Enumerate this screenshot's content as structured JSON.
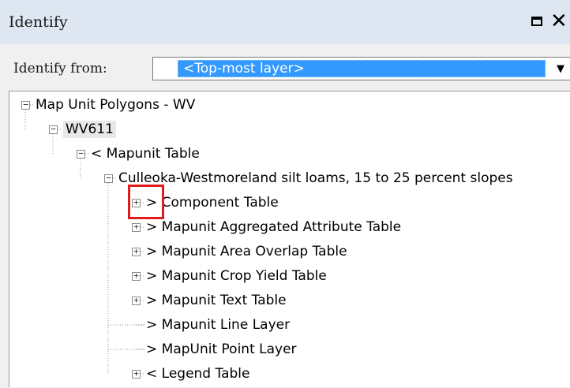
{
  "window": {
    "title": "Identify",
    "restore_icon": "restore-icon",
    "close_glyph": "✕"
  },
  "identify_from": {
    "label": "Identify from:",
    "value": "<Top-most layer>",
    "dropdown_glyph": "▼"
  },
  "tree": [
    {
      "label": "Map Unit Polygons - WV",
      "expander": "−",
      "level": 0
    },
    {
      "label": "WV611",
      "expander": "−",
      "level": 1,
      "selected": true
    },
    {
      "label": "< Mapunit Table",
      "expander": "−",
      "level": 2
    },
    {
      "label": "Culleoka-Westmoreland silt loams, 15 to 25 percent slopes",
      "expander": "−",
      "level": 3
    },
    {
      "label": "> Component Table",
      "expander": "+",
      "level": 4,
      "highlighted": true
    },
    {
      "label": "> Mapunit Aggregated Attribute Table",
      "expander": "+",
      "level": 4
    },
    {
      "label": "> Mapunit Area Overlap Table",
      "expander": "+",
      "level": 4
    },
    {
      "label": "> Mapunit Crop Yield Table",
      "expander": "+",
      "level": 4
    },
    {
      "label": "> Mapunit Text Table",
      "expander": "+",
      "level": 4
    },
    {
      "label": "> Mapunit Line Layer",
      "expander": "",
      "level": 4
    },
    {
      "label": "> MapUnit Point Layer",
      "expander": "",
      "level": 4
    },
    {
      "label": "<  Legend Table",
      "expander": "+",
      "level": 4
    }
  ],
  "colors": {
    "titlebar": "#dde6f1",
    "selection": "#3399ff",
    "highlight": "#e11b1b"
  }
}
